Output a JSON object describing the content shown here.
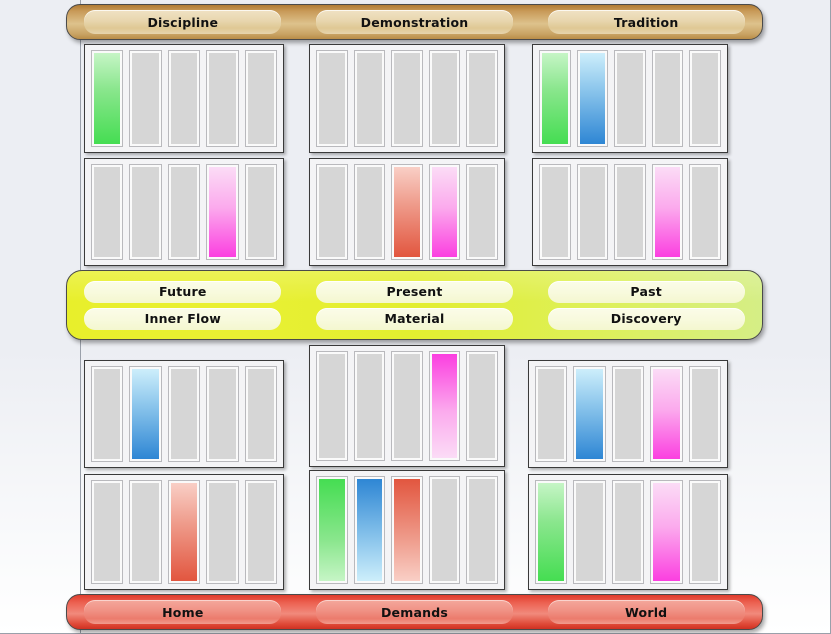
{
  "background": {
    "top_color": "#eceef3",
    "bottom_color": "#ffffff"
  },
  "top_bar": {
    "name": "top-label-bar",
    "color": "#c89a58",
    "labels": [
      "Discipline",
      "Demonstration",
      "Tradition"
    ]
  },
  "middle_bar": {
    "name": "middle-label-bar",
    "color": "#e4ee2a",
    "row1": [
      "Future",
      "Present",
      "Past"
    ],
    "row2": [
      "Inner Flow",
      "Material",
      "Discovery"
    ]
  },
  "bottom_bar": {
    "name": "bottom-label-bar",
    "color": "#e04a38",
    "labels": [
      "Home",
      "Demands",
      "World"
    ]
  },
  "palette": {
    "green": "#45dd52",
    "blue": "#2e86d4",
    "red": "#e2563f",
    "pink": "#fb3fe0",
    "empty": "#d6d6d6"
  },
  "panels": [
    {
      "id": "top-left-upper",
      "column": "left",
      "row": "top",
      "slot_count": 5,
      "bars": [
        "green",
        "empty",
        "empty",
        "empty",
        "empty"
      ]
    },
    {
      "id": "top-left-lower",
      "column": "left",
      "row": "top",
      "slot_count": 5,
      "bars": [
        "empty",
        "empty",
        "empty",
        "pink",
        "empty"
      ]
    },
    {
      "id": "top-middle-upper",
      "column": "middle",
      "row": "top",
      "slot_count": 5,
      "bars": [
        "empty",
        "empty",
        "empty",
        "empty",
        "empty"
      ]
    },
    {
      "id": "top-middle-lower",
      "column": "middle",
      "row": "top",
      "slot_count": 5,
      "bars": [
        "empty",
        "empty",
        "red",
        "pink",
        "empty"
      ]
    },
    {
      "id": "top-right-upper",
      "column": "right",
      "row": "top",
      "slot_count": 5,
      "bars": [
        "green",
        "blue",
        "empty",
        "empty",
        "empty"
      ]
    },
    {
      "id": "top-right-lower",
      "column": "right",
      "row": "top",
      "slot_count": 5,
      "bars": [
        "empty",
        "empty",
        "empty",
        "pink",
        "empty"
      ]
    },
    {
      "id": "bottom-left-upper",
      "column": "left",
      "row": "bottom",
      "slot_count": 5,
      "bars": [
        "empty",
        "blue",
        "empty",
        "empty",
        "empty"
      ]
    },
    {
      "id": "bottom-left-lower",
      "column": "left",
      "row": "bottom",
      "slot_count": 5,
      "bars": [
        "empty",
        "empty",
        "red",
        "empty",
        "empty"
      ]
    },
    {
      "id": "bottom-middle-upper",
      "column": "middle",
      "row": "bottom",
      "slot_count": 5,
      "bars": [
        "empty",
        "empty",
        "empty",
        "pink-r",
        "empty"
      ]
    },
    {
      "id": "bottom-middle-lower",
      "column": "middle",
      "row": "bottom",
      "slot_count": 5,
      "bars": [
        "green-r",
        "blue-r",
        "red-r",
        "empty",
        "empty"
      ]
    },
    {
      "id": "bottom-right-upper",
      "column": "right",
      "row": "bottom",
      "slot_count": 5,
      "bars": [
        "empty",
        "blue",
        "empty",
        "pink",
        "empty"
      ]
    },
    {
      "id": "bottom-right-lower",
      "column": "right",
      "row": "bottom",
      "slot_count": 5,
      "bars": [
        "green",
        "empty",
        "empty",
        "pink",
        "empty"
      ]
    }
  ]
}
